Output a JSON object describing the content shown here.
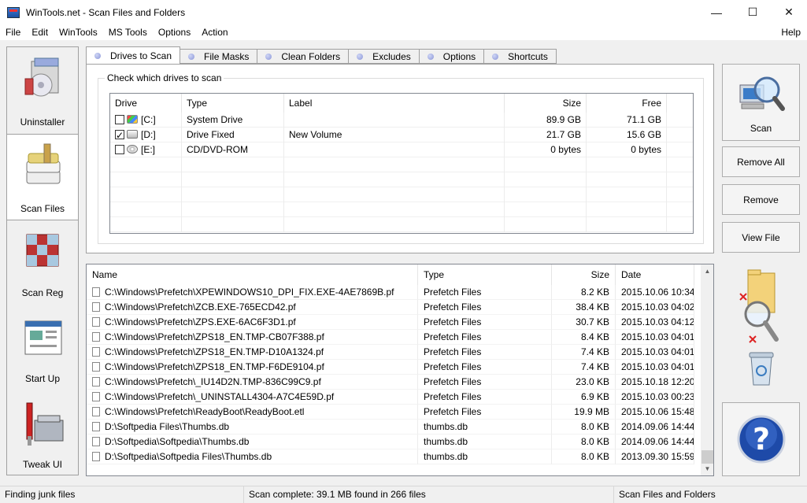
{
  "window": {
    "title": "WinTools.net - Scan Files and Folders",
    "min": "—",
    "max": "☐",
    "close": "✕"
  },
  "menu": [
    "File",
    "Edit",
    "WinTools",
    "MS Tools",
    "Options",
    "Action"
  ],
  "menu_help": "Help",
  "sidebar": [
    {
      "label": "Uninstaller",
      "icon": "uninstaller-icon"
    },
    {
      "label": "Scan Files",
      "icon": "scan-files-icon",
      "active": true
    },
    {
      "label": "Scan Reg",
      "icon": "scan-reg-icon"
    },
    {
      "label": "Start Up",
      "icon": "startup-icon"
    },
    {
      "label": "Tweak UI",
      "icon": "tweak-ui-icon"
    }
  ],
  "tabs": [
    "Drives to Scan",
    "File Masks",
    "Clean Folders",
    "Excludes",
    "Options",
    "Shortcuts"
  ],
  "group_title": "Check which drives to scan",
  "drives": {
    "headers": [
      "Drive",
      "Type",
      "Label",
      "Size",
      "Free"
    ],
    "rows": [
      {
        "drive": "[C:]",
        "type": "System Drive",
        "label": "",
        "size": "89.9 GB",
        "free": "71.1 GB",
        "checked": false,
        "icon": "win"
      },
      {
        "drive": "[D:]",
        "type": "Drive Fixed",
        "label": "New Volume",
        "size": "21.7 GB",
        "free": "15.6 GB",
        "checked": true,
        "icon": "hdd"
      },
      {
        "drive": "[E:]",
        "type": "CD/DVD-ROM",
        "label": "",
        "size": "0 bytes",
        "free": "0 bytes",
        "checked": false,
        "icon": "cd"
      }
    ]
  },
  "buttons": {
    "scan": "Scan",
    "remove_all": "Remove All",
    "remove": "Remove",
    "view_file": "View File"
  },
  "files": {
    "headers": [
      "Name",
      "Type",
      "Size",
      "Date"
    ],
    "rows": [
      [
        "C:\\Windows\\Prefetch\\XPEWINDOWS10_DPI_FIX.EXE-4AE7869B.pf",
        "Prefetch Files",
        "8.2 KB",
        "2015.10.06 10:34"
      ],
      [
        "C:\\Windows\\Prefetch\\ZCB.EXE-765ECD42.pf",
        "Prefetch Files",
        "38.4 KB",
        "2015.10.03 04:02"
      ],
      [
        "C:\\Windows\\Prefetch\\ZPS.EXE-6AC6F3D1.pf",
        "Prefetch Files",
        "30.7 KB",
        "2015.10.03 04:12"
      ],
      [
        "C:\\Windows\\Prefetch\\ZPS18_EN.TMP-CB07F388.pf",
        "Prefetch Files",
        "8.4 KB",
        "2015.10.03 04:01"
      ],
      [
        "C:\\Windows\\Prefetch\\ZPS18_EN.TMP-D10A1324.pf",
        "Prefetch Files",
        "7.4 KB",
        "2015.10.03 04:01"
      ],
      [
        "C:\\Windows\\Prefetch\\ZPS18_EN.TMP-F6DE9104.pf",
        "Prefetch Files",
        "7.4 KB",
        "2015.10.03 04:01"
      ],
      [
        "C:\\Windows\\Prefetch\\_IU14D2N.TMP-836C99C9.pf",
        "Prefetch Files",
        "23.0 KB",
        "2015.10.18 12:20"
      ],
      [
        "C:\\Windows\\Prefetch\\_UNINSTALL4304-A7C4E59D.pf",
        "Prefetch Files",
        "6.9 KB",
        "2015.10.03 00:23"
      ],
      [
        "C:\\Windows\\Prefetch\\ReadyBoot\\ReadyBoot.etl",
        "Prefetch Files",
        "19.9 MB",
        "2015.10.06 15:48"
      ],
      [
        "D:\\Softpedia Files\\Thumbs.db",
        "thumbs.db",
        "8.0 KB",
        "2014.09.06 14:44"
      ],
      [
        "D:\\Softpedia\\Softpedia\\Thumbs.db",
        "thumbs.db",
        "8.0 KB",
        "2014.09.06 14:44"
      ],
      [
        "D:\\Softpedia\\Softpedia Files\\Thumbs.db",
        "thumbs.db",
        "8.0 KB",
        "2013.09.30 15:59"
      ]
    ]
  },
  "status": {
    "left": "Finding junk files",
    "middle": "Scan complete: 39.1 MB found in 266 files",
    "right": "Scan Files and Folders"
  }
}
